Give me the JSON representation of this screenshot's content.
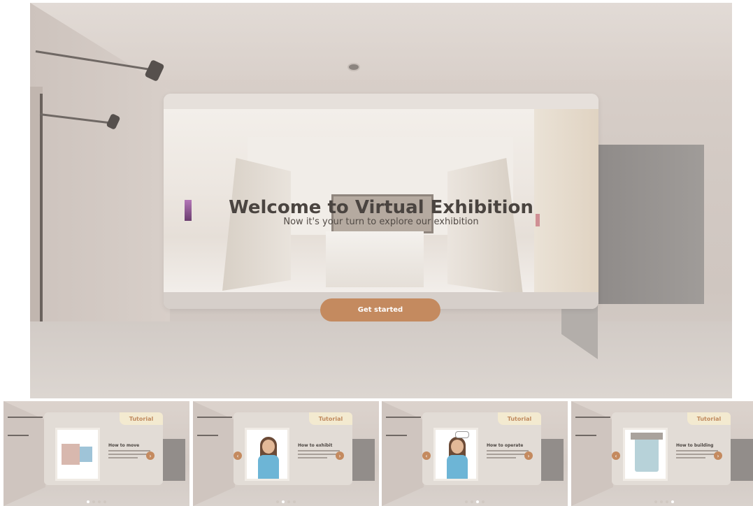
{
  "welcome": {
    "title": "Welcome to Virtual Exhibition",
    "subtitle": "Now it's your turn to explore our exhibition",
    "cta_label": "Get started"
  },
  "tutorials": [
    {
      "tab_label": "Tutorial",
      "heading": "How to move",
      "has_prev": false,
      "has_next": true,
      "active_dot": 0,
      "dot_count": 4,
      "image_kind": "controls"
    },
    {
      "tab_label": "Tutorial",
      "heading": "How to exhibit",
      "has_prev": true,
      "has_next": true,
      "active_dot": 1,
      "dot_count": 4,
      "image_kind": "avatar"
    },
    {
      "tab_label": "Tutorial",
      "heading": "How to operate",
      "has_prev": true,
      "has_next": true,
      "active_dot": 2,
      "dot_count": 4,
      "image_kind": "avatar-speech"
    },
    {
      "tab_label": "Tutorial",
      "heading": "How to building",
      "has_prev": true,
      "has_next": true,
      "active_dot": 3,
      "dot_count": 4,
      "image_kind": "building"
    }
  ],
  "colors": {
    "accent": "#c48a5f",
    "tab_background": "#f3ead0",
    "panel": "#e4ded9"
  }
}
